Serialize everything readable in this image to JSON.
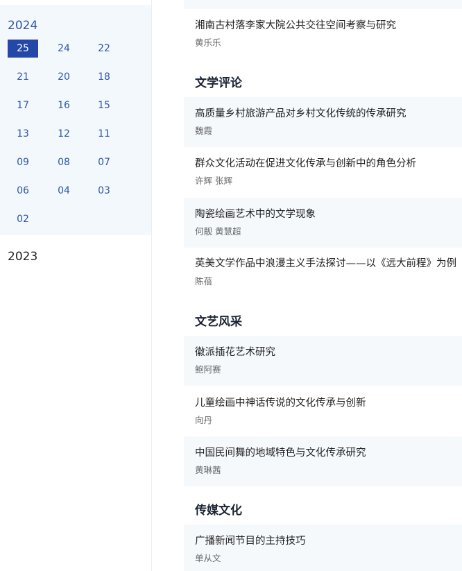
{
  "sidebar": {
    "years": [
      {
        "label": "2024",
        "issues": [
          "25",
          "24",
          "22",
          "21",
          "20",
          "18",
          "17",
          "16",
          "15",
          "13",
          "12",
          "11",
          "09",
          "08",
          "07",
          "06",
          "04",
          "03",
          "02"
        ],
        "active_issue": "25"
      },
      {
        "label": "2023"
      }
    ]
  },
  "main": {
    "top_article": {
      "title": "湘南古村落李家大院公共交往空间考察与研究",
      "authors": "黄乐乐"
    },
    "sections": [
      {
        "heading": "文学评论",
        "articles": [
          {
            "title": "高质量乡村旅游产品对乡村文化传统的传承研究",
            "authors": "魏霞"
          },
          {
            "title": "群众文化活动在促进文化传承与创新中的角色分析",
            "authors": "许辉 张辉"
          },
          {
            "title": "陶瓷绘画艺术中的文学现象",
            "authors": "何靓 黄慧超"
          },
          {
            "title": "英美文学作品中浪漫主义手法探讨——以《远大前程》为例",
            "authors": "陈蓓"
          }
        ]
      },
      {
        "heading": "文艺风采",
        "articles": [
          {
            "title": "徽派插花艺术研究",
            "authors": "鲍阿赛"
          },
          {
            "title": "儿童绘画中神话传说的文化传承与创新",
            "authors": "向丹"
          },
          {
            "title": "中国民间舞的地域特色与文化传承研究",
            "authors": "黄琳茜"
          }
        ]
      },
      {
        "heading": "传媒文化",
        "articles": [
          {
            "title": "广播新闻节目的主持技巧",
            "authors": "单从文"
          }
        ]
      }
    ]
  }
}
